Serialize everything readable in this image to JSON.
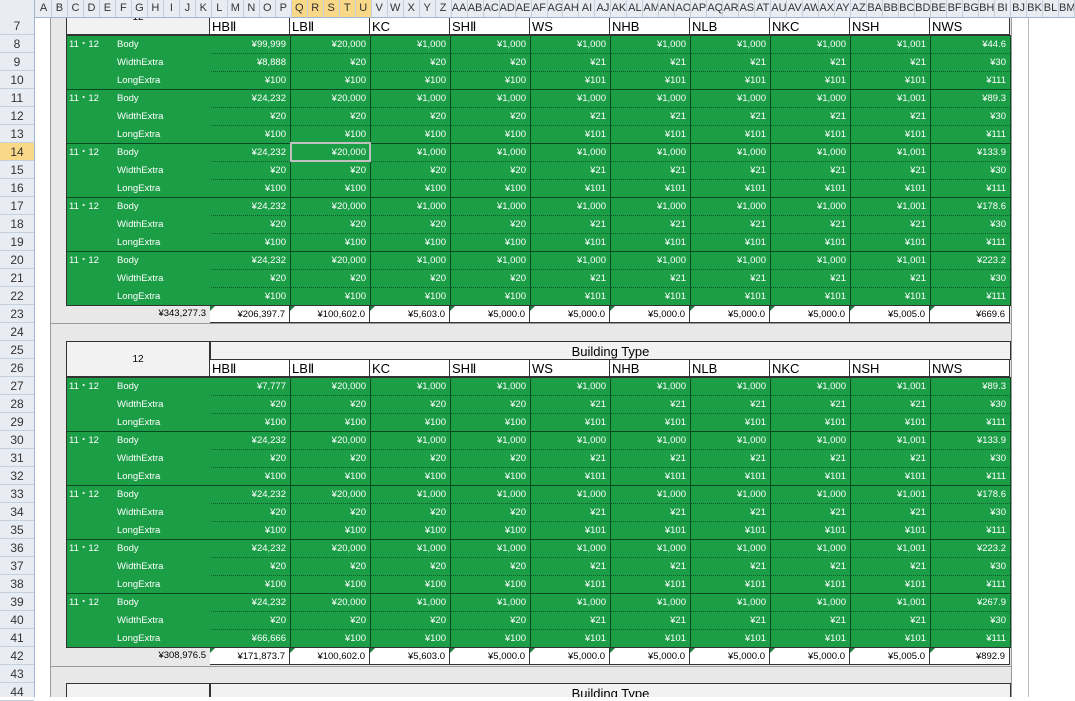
{
  "spreadsheet": {
    "column_headers": [
      "A",
      "B",
      "C",
      "D",
      "E",
      "F",
      "G",
      "H",
      "I",
      "J",
      "K",
      "L",
      "M",
      "N",
      "O",
      "P",
      "Q",
      "R",
      "S",
      "T",
      "U",
      "V",
      "W",
      "X",
      "Y",
      "Z",
      "AA",
      "AB",
      "AC",
      "AD",
      "AE",
      "AF",
      "AG",
      "AH",
      "AI",
      "AJ",
      "AK",
      "AL",
      "AM",
      "AN",
      "AO",
      "AP",
      "AQ",
      "AR",
      "AS",
      "AT",
      "AU",
      "AV",
      "AW",
      "AX",
      "AY",
      "AZ",
      "BA",
      "BB",
      "BC",
      "BD",
      "BE",
      "BF",
      "BG",
      "BH",
      "BI",
      "BJ",
      "BK",
      "BL",
      "BM"
    ],
    "selected_columns": [
      "Q",
      "R",
      "S",
      "T",
      "U"
    ],
    "row_numbers": [
      "7",
      "8",
      "9",
      "10",
      "11",
      "12",
      "13",
      "14",
      "15",
      "16",
      "17",
      "18",
      "19",
      "20",
      "21",
      "22",
      "23",
      "24",
      "25",
      "26",
      "27",
      "28",
      "29",
      "30",
      "31",
      "32",
      "33",
      "34",
      "35",
      "36",
      "37",
      "38",
      "39",
      "40",
      "41",
      "42",
      "43",
      "44"
    ],
    "selected_row": "14",
    "partial_top_label": "12"
  },
  "block_header_label": "12",
  "building_type_title": "Building Type",
  "building_types": [
    "HBⅡ",
    "LBⅡ",
    "KC",
    "SHⅡ",
    "WS",
    "NHB",
    "NLB",
    "NKC",
    "NSH",
    "NWS"
  ],
  "item_labels": [
    "Body",
    "WidthExtra",
    "LongExtra"
  ],
  "group_label": "11・12",
  "tables": [
    {
      "groups": [
        [
          [
            "¥99,999",
            "¥20,000",
            "¥1,000",
            "¥1,000",
            "¥1,000",
            "¥1,000",
            "¥1,000",
            "¥1,000",
            "¥1,001",
            "¥44.6"
          ],
          [
            "¥8,888",
            "¥20",
            "¥20",
            "¥20",
            "¥21",
            "¥21",
            "¥21",
            "¥21",
            "¥21",
            "¥30"
          ],
          [
            "¥100",
            "¥100",
            "¥100",
            "¥100",
            "¥101",
            "¥101",
            "¥101",
            "¥101",
            "¥101",
            "¥111"
          ]
        ],
        [
          [
            "¥24,232",
            "¥20,000",
            "¥1,000",
            "¥1,000",
            "¥1,000",
            "¥1,000",
            "¥1,000",
            "¥1,000",
            "¥1,001",
            "¥89.3"
          ],
          [
            "¥20",
            "¥20",
            "¥20",
            "¥20",
            "¥21",
            "¥21",
            "¥21",
            "¥21",
            "¥21",
            "¥30"
          ],
          [
            "¥100",
            "¥100",
            "¥100",
            "¥100",
            "¥101",
            "¥101",
            "¥101",
            "¥101",
            "¥101",
            "¥111"
          ]
        ],
        [
          [
            "¥24,232",
            "¥20,000",
            "¥1,000",
            "¥1,000",
            "¥1,000",
            "¥1,000",
            "¥1,000",
            "¥1,000",
            "¥1,001",
            "¥133.9"
          ],
          [
            "¥20",
            "¥20",
            "¥20",
            "¥20",
            "¥21",
            "¥21",
            "¥21",
            "¥21",
            "¥21",
            "¥30"
          ],
          [
            "¥100",
            "¥100",
            "¥100",
            "¥100",
            "¥101",
            "¥101",
            "¥101",
            "¥101",
            "¥101",
            "¥111"
          ]
        ],
        [
          [
            "¥24,232",
            "¥20,000",
            "¥1,000",
            "¥1,000",
            "¥1,000",
            "¥1,000",
            "¥1,000",
            "¥1,000",
            "¥1,001",
            "¥178.6"
          ],
          [
            "¥20",
            "¥20",
            "¥20",
            "¥20",
            "¥21",
            "¥21",
            "¥21",
            "¥21",
            "¥21",
            "¥30"
          ],
          [
            "¥100",
            "¥100",
            "¥100",
            "¥100",
            "¥101",
            "¥101",
            "¥101",
            "¥101",
            "¥101",
            "¥111"
          ]
        ],
        [
          [
            "¥24,232",
            "¥20,000",
            "¥1,000",
            "¥1,000",
            "¥1,000",
            "¥1,000",
            "¥1,000",
            "¥1,000",
            "¥1,001",
            "¥223.2"
          ],
          [
            "¥20",
            "¥20",
            "¥20",
            "¥20",
            "¥21",
            "¥21",
            "¥21",
            "¥21",
            "¥21",
            "¥30"
          ],
          [
            "¥100",
            "¥100",
            "¥100",
            "¥100",
            "¥101",
            "¥101",
            "¥101",
            "¥101",
            "¥101",
            "¥111"
          ]
        ]
      ],
      "totals": [
        "¥343,277.3",
        "¥206,397.7",
        "¥100,602.0",
        "¥5,603.0",
        "¥5,000.0",
        "¥5,000.0",
        "¥5,000.0",
        "¥5,000.0",
        "¥5,000.0",
        "¥5,005.0",
        "¥669.6"
      ]
    },
    {
      "groups": [
        [
          [
            "¥7,777",
            "¥20,000",
            "¥1,000",
            "¥1,000",
            "¥1,000",
            "¥1,000",
            "¥1,000",
            "¥1,000",
            "¥1,001",
            "¥89.3"
          ],
          [
            "¥20",
            "¥20",
            "¥20",
            "¥20",
            "¥21",
            "¥21",
            "¥21",
            "¥21",
            "¥21",
            "¥30"
          ],
          [
            "¥100",
            "¥100",
            "¥100",
            "¥100",
            "¥101",
            "¥101",
            "¥101",
            "¥101",
            "¥101",
            "¥111"
          ]
        ],
        [
          [
            "¥24,232",
            "¥20,000",
            "¥1,000",
            "¥1,000",
            "¥1,000",
            "¥1,000",
            "¥1,000",
            "¥1,000",
            "¥1,001",
            "¥133.9"
          ],
          [
            "¥20",
            "¥20",
            "¥20",
            "¥20",
            "¥21",
            "¥21",
            "¥21",
            "¥21",
            "¥21",
            "¥30"
          ],
          [
            "¥100",
            "¥100",
            "¥100",
            "¥100",
            "¥101",
            "¥101",
            "¥101",
            "¥101",
            "¥101",
            "¥111"
          ]
        ],
        [
          [
            "¥24,232",
            "¥20,000",
            "¥1,000",
            "¥1,000",
            "¥1,000",
            "¥1,000",
            "¥1,000",
            "¥1,000",
            "¥1,001",
            "¥178.6"
          ],
          [
            "¥20",
            "¥20",
            "¥20",
            "¥20",
            "¥21",
            "¥21",
            "¥21",
            "¥21",
            "¥21",
            "¥30"
          ],
          [
            "¥100",
            "¥100",
            "¥100",
            "¥100",
            "¥101",
            "¥101",
            "¥101",
            "¥101",
            "¥101",
            "¥111"
          ]
        ],
        [
          [
            "¥24,232",
            "¥20,000",
            "¥1,000",
            "¥1,000",
            "¥1,000",
            "¥1,000",
            "¥1,000",
            "¥1,000",
            "¥1,001",
            "¥223.2"
          ],
          [
            "¥20",
            "¥20",
            "¥20",
            "¥20",
            "¥21",
            "¥21",
            "¥21",
            "¥21",
            "¥21",
            "¥30"
          ],
          [
            "¥100",
            "¥100",
            "¥100",
            "¥100",
            "¥101",
            "¥101",
            "¥101",
            "¥101",
            "¥101",
            "¥111"
          ]
        ],
        [
          [
            "¥24,232",
            "¥20,000",
            "¥1,000",
            "¥1,000",
            "¥1,000",
            "¥1,000",
            "¥1,000",
            "¥1,000",
            "¥1,001",
            "¥267.9"
          ],
          [
            "¥20",
            "¥20",
            "¥20",
            "¥20",
            "¥21",
            "¥21",
            "¥21",
            "¥21",
            "¥21",
            "¥30"
          ],
          [
            "¥66,666",
            "¥100",
            "¥100",
            "¥100",
            "¥101",
            "¥101",
            "¥101",
            "¥101",
            "¥101",
            "¥111"
          ]
        ]
      ],
      "totals": [
        "¥308,976.5",
        "¥171,873.7",
        "¥100,602.0",
        "¥5,603.0",
        "¥5,000.0",
        "¥5,000.0",
        "¥5,000.0",
        "¥5,000.0",
        "¥5,000.0",
        "¥5,005.0",
        "¥892.9"
      ]
    }
  ],
  "colors": {
    "green_fill": "#1c9e47",
    "header_bg": "#e9edf3",
    "selection_highlight": "#f9d887"
  }
}
